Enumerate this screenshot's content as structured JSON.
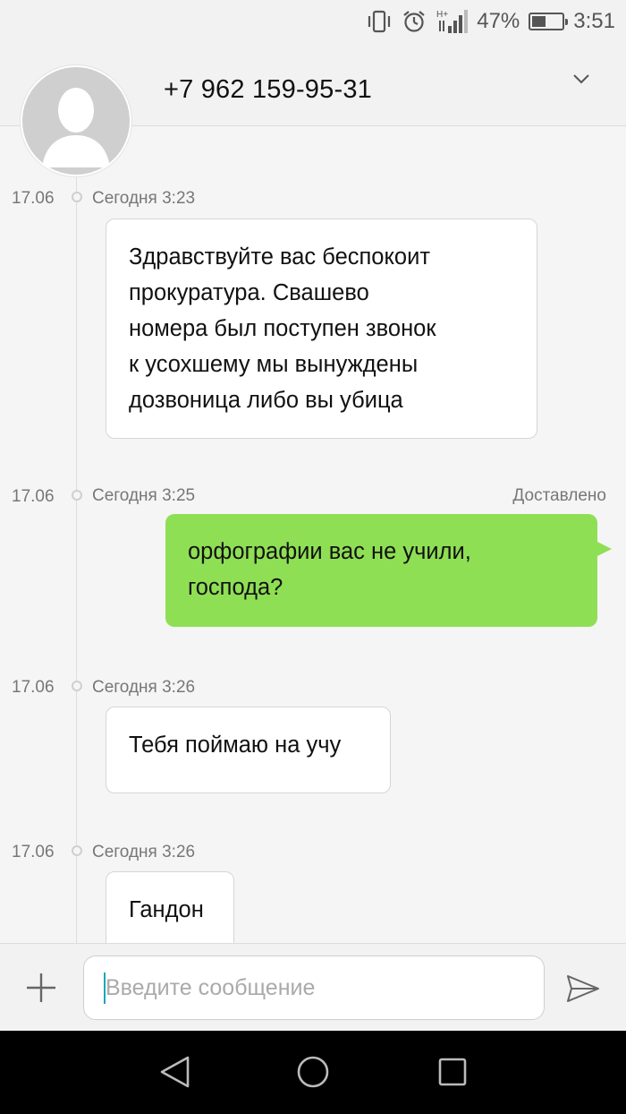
{
  "status_bar": {
    "network": "H+",
    "battery_text": "47%",
    "battery_level": 0.47,
    "time": "3:51",
    "icons": [
      "vibrate-icon",
      "alarm-icon",
      "signal-icon",
      "battery-icon"
    ]
  },
  "header": {
    "contact_number": "+7 962 159-95-31",
    "icons": [
      "avatar-placeholder-icon",
      "chevron-down-icon"
    ]
  },
  "messages": [
    {
      "date": "17.06",
      "time": "Сегодня 3:23",
      "direction": "incoming",
      "text": "Здравствуйте вас беспокоит\nпрокуратура. Свашево\nномера был поступен звонок\nк усохшему мы вынуждены\nдозвоница либо вы убица"
    },
    {
      "date": "17.06",
      "time": "Сегодня 3:25",
      "direction": "outgoing",
      "status": "Доставлено",
      "text": "орфографии вас не учили,\nгоспода?"
    },
    {
      "date": "17.06",
      "time": "Сегодня 3:26",
      "direction": "incoming",
      "text": "Тебя поймаю на учу"
    },
    {
      "date": "17.06",
      "time": "Сегодня 3:26",
      "direction": "incoming",
      "text": "Гандон"
    }
  ],
  "composer": {
    "placeholder": "Введите сообщение",
    "icons": [
      "plus-icon",
      "send-icon"
    ]
  },
  "nav_bar": {
    "icons": [
      "back-icon",
      "home-icon",
      "recent-apps-icon"
    ]
  },
  "colors": {
    "outgoing_bubble": "#8fdf55",
    "incoming_bubble": "#ffffff",
    "background": "#f5f5f5",
    "caret": "#1aa6b7"
  }
}
